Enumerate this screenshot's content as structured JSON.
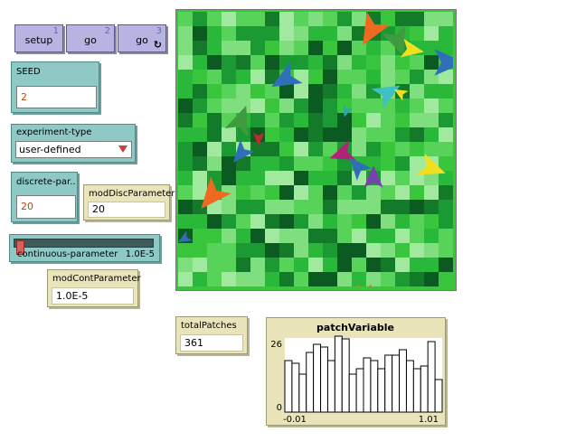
{
  "buttons": {
    "setup": {
      "label": "setup",
      "key": "1"
    },
    "go_once": {
      "label": "go",
      "key": "2"
    },
    "go_forever": {
      "label": "go",
      "key": "3",
      "forever_icon": "forever-icon"
    }
  },
  "seed": {
    "label": "SEED",
    "value": "2"
  },
  "experiment_type": {
    "label": "experiment-type",
    "value": "user-defined"
  },
  "discrete_parameter": {
    "label": "discrete-par...",
    "value": "20"
  },
  "mod_disc_parameter": {
    "label": "modDiscParameter",
    "value": "20"
  },
  "continuous_parameter": {
    "label": "continuous-parameter",
    "value": "1.0E-5",
    "fraction": 0.0
  },
  "mod_cont_parameter": {
    "label": "modContParameter",
    "value": "1.0E-5"
  },
  "total_patches": {
    "label": "totalPatches",
    "value": "361"
  },
  "plot": {
    "title": "patchVariable",
    "y_max_label": "26",
    "y_min_label": "0",
    "x_min_label": "-0.01",
    "x_max_label": "1.01"
  },
  "chart_data": {
    "type": "bar",
    "title": "patchVariable",
    "xlabel": "",
    "ylabel": "",
    "xlim": [
      -0.01,
      1.01
    ],
    "ylim": [
      0,
      26
    ],
    "values": [
      19,
      18,
      14,
      22,
      25,
      24,
      19,
      28,
      27,
      14,
      16,
      20,
      19,
      16,
      21,
      21,
      23,
      19,
      16,
      17,
      26,
      12
    ]
  },
  "colors": {
    "button_bg": "#b8b4e2",
    "input_widget_bg": "#8fc9c6",
    "monitor_bg": "#e9e4b9",
    "patch_greens": [
      "#0b5a22",
      "#137a2a",
      "#1b9a34",
      "#2ab83a",
      "#39c63c",
      "#57d35a",
      "#7fdf7f",
      "#a2e9a0"
    ]
  },
  "turtles": [
    {
      "color": "#ee6a20",
      "heading": 210,
      "size": 1.4
    },
    {
      "color": "#3f9b3f",
      "heading": 160,
      "size": 1.3
    },
    {
      "color": "#f0e020",
      "heading": 100,
      "size": 1.0
    },
    {
      "color": "#2f6fb8",
      "heading": 240,
      "size": 1.3
    },
    {
      "color": "#2f6fb8",
      "heading": 90,
      "size": 1.4
    },
    {
      "color": "#3ec0c4",
      "heading": 60,
      "size": 1.2
    },
    {
      "color": "#f0e020",
      "heading": 300,
      "size": 0.6
    },
    {
      "color": "#2ea6b0",
      "heading": 200,
      "size": 0.5
    },
    {
      "color": "#3f9b3f",
      "heading": 20,
      "size": 1.3
    },
    {
      "color": "#c42a2a",
      "heading": 180,
      "size": 0.6
    },
    {
      "color": "#2f6fb8",
      "heading": 220,
      "size": 1.0
    },
    {
      "color": "#b0237a",
      "heading": 250,
      "size": 1.1
    },
    {
      "color": "#2f6fb8",
      "heading": 320,
      "size": 1.0
    },
    {
      "color": "#7a3fb0",
      "heading": 0,
      "size": 1.0
    },
    {
      "color": "#f0e020",
      "heading": 110,
      "size": 1.2
    },
    {
      "color": "#ee6a20",
      "heading": 220,
      "size": 1.4
    },
    {
      "color": "#2f6fb8",
      "heading": 240,
      "size": 0.6
    },
    {
      "color": "#ee6a20",
      "heading": 180,
      "size": 0.8
    }
  ]
}
